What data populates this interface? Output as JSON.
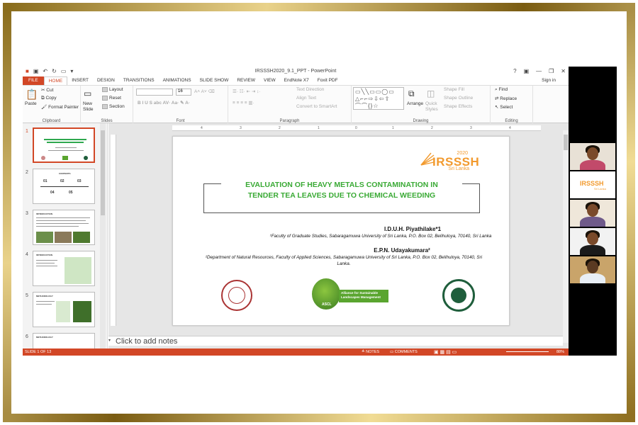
{
  "window": {
    "title": "IRSSSH2020_9.1_PPT - PowerPoint",
    "help": "?",
    "signin": "Sign in"
  },
  "tabs": [
    "FILE",
    "HOME",
    "INSERT",
    "DESIGN",
    "TRANSITIONS",
    "ANIMATIONS",
    "SLIDE SHOW",
    "REVIEW",
    "VIEW",
    "EndNote X7",
    "Foxit PDF"
  ],
  "ribbon": {
    "clipboard": {
      "label": "Clipboard",
      "paste": "Paste",
      "cut": "Cut",
      "copy": "Copy",
      "format_painter": "Format Painter"
    },
    "slides": {
      "label": "Slides",
      "new_slide": "New Slide",
      "layout": "Layout",
      "reset": "Reset",
      "section": "Section"
    },
    "font": {
      "label": "Font",
      "size": "16"
    },
    "paragraph": {
      "label": "Paragraph",
      "text_direction": "Text Direction",
      "align_text": "Align Text",
      "convert_smartart": "Convert to SmartArt"
    },
    "drawing": {
      "label": "Drawing",
      "arrange": "Arrange",
      "quick_styles": "Quick Styles",
      "shape_fill": "Shape Fill",
      "shape_outline": "Shape Outline",
      "shape_effects": "Shape Effects"
    },
    "editing": {
      "label": "Editing",
      "find": "Find",
      "replace": "Replace",
      "select": "Select"
    }
  },
  "thumbnails": {
    "numbers": [
      "1",
      "2",
      "3",
      "4",
      "5",
      "6"
    ],
    "slide2_title": "CONTENTS",
    "slide2_items": [
      "01",
      "02",
      "03",
      "04",
      "05"
    ],
    "slide3_title": "INTRODUCTION",
    "slide4_title": "INTRODUCTION",
    "slide5_title": "METHODOLOGY",
    "slide6_title": "METHODOLOGY"
  },
  "slide": {
    "logo_year": "2020",
    "logo_name": "IRSSSH",
    "logo_country": "Sri Lanka",
    "title_line1": "EVALUATION OF HEAVY METALS CONTAMINATION IN",
    "title_line2": "TENDER TEA LEAVES DUE TO CHEMICAL WEEDING",
    "author1": "I.D.U.H. Piyathilake*1",
    "affil1": "¹Faculty of Graduate Studies, Sabaragamuwa University of Sri Lanka, P.O. Box 02, Belihuloya, 70140, Sri Lanka",
    "author2": "E.P.N. Udayakumara²",
    "affil2": "²Department of Natural Resources, Faculty of Applied Sciences, Sabaragamuwa University of Sri Lanka, P.O. Box 02, Belihuloya, 70140, Sri Lanka.",
    "ascl_label": "ASCL",
    "ascl_band": "Alliance for Sustainable Landscapes Management"
  },
  "ruler_ticks": [
    "4",
    "3",
    "2",
    "1",
    "0",
    "1",
    "2",
    "3",
    "4"
  ],
  "notes_placeholder": "Click to add notes",
  "status": {
    "slide_of": "SLIDE 1 OF 13",
    "notes": "NOTES",
    "comments": "COMMENTS",
    "zoom": "88%"
  },
  "participants": {
    "tile2_logo": "IRSSSH",
    "tile2_country": "Sri Lanka"
  },
  "colors": {
    "accent": "#d24726",
    "title_green": "#3aaa35",
    "logo_orange": "#f29a2e",
    "frame_gold": "#c9a85c"
  }
}
